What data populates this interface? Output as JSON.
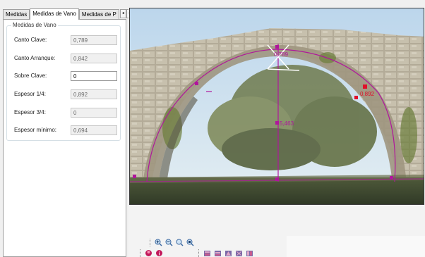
{
  "tabs": [
    {
      "label": "Medidas"
    },
    {
      "label": "Medidas de Vano"
    },
    {
      "label": "Medidas de P"
    }
  ],
  "tab_scroll": {
    "left": "◂",
    "right": "▸"
  },
  "group": {
    "title": "Medidas de Vano",
    "rows": [
      {
        "label": "Canto Clave:",
        "value": "0,789"
      },
      {
        "label": "Canto Arranque:",
        "value": "0,842"
      },
      {
        "label": "Sobre Clave:",
        "value": "0"
      },
      {
        "label": "Espesor 1/4:",
        "value": "0,892"
      },
      {
        "label": "Espesor 3/4:",
        "value": "0"
      },
      {
        "label": "Espesor mínimo:",
        "value": "0,694"
      }
    ]
  },
  "annotations": {
    "crown": "0,789",
    "right_quarter": "0,892",
    "height": "5,463"
  },
  "colors": {
    "measure_line": "#b0169c",
    "red_marker": "#e0102a"
  },
  "toolbar": {
    "zoom_icons": [
      "zoom-in-icon",
      "zoom-out-icon",
      "zoom-fit-icon",
      "zoom-actual-icon"
    ],
    "record_icons": [
      "record-icon",
      "info-icon"
    ],
    "tool_icons": [
      "tool-1-icon",
      "tool-2-icon",
      "tool-3-icon",
      "tool-4-icon",
      "tool-5-icon"
    ]
  }
}
